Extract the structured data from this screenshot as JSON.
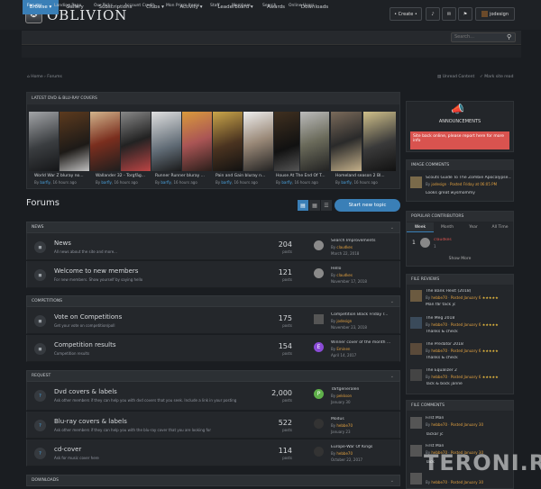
{
  "header": {
    "logo_text": "OBLIVION",
    "create_label": "• Create •",
    "user_label": "jodesign",
    "search_placeholder": "Search..."
  },
  "nav": {
    "tabs": [
      "Browse",
      "Gallery",
      "Subscriptions",
      "Clubs",
      "Activity",
      "Leaderboard",
      "Awards",
      "Downloads"
    ],
    "subtabs": [
      "Forums",
      "Landing Page",
      "Our Picks",
      "Account Credit",
      "Mon Prism Items",
      "Staff",
      "Members",
      "Search",
      "Online Users"
    ]
  },
  "breadcrumb": {
    "home": "Home",
    "current": "Forums"
  },
  "top_links": {
    "unread": "Unread Content",
    "mark_read": "Mark site read"
  },
  "latest_covers": {
    "title": "LATEST DVD & BLU-RAY COVERS",
    "items": [
      {
        "title": "World War Z bluray no...",
        "by": "barfly",
        "time": "16 hours ago"
      },
      {
        "title": "Wallander 32 - Torgfäg...",
        "by": "barfly",
        "time": "16 hours ago"
      },
      {
        "title": "Runner Runner bluray ...",
        "by": "barfly",
        "time": "16 hours ago"
      },
      {
        "title": "Pain and Gain bluray n...",
        "by": "barfly",
        "time": "16 hours ago"
      },
      {
        "title": "House At The End Of T...",
        "by": "barfly",
        "time": "16 hours ago"
      },
      {
        "title": "Homeland season 2 Bl...",
        "by": "barfly",
        "time": "16 hours ago"
      }
    ]
  },
  "forums_heading": "Forums",
  "start_topic": "Start new topic",
  "categories": [
    {
      "name": "NEWS",
      "forums": [
        {
          "title": "News",
          "desc": "All news about the site and more...",
          "count": "204",
          "posts": "posts",
          "last_title": "Search Improvements",
          "last_by": "claudkes",
          "last_date": "March 22, 2018",
          "avatar": "",
          "avatar_color": "#888"
        },
        {
          "title": "Welcome to new members",
          "desc": "For new members. Show yourself by saying hello",
          "count": "121",
          "posts": "posts",
          "last_title": "Hello",
          "last_by": "claudkes",
          "last_date": "November 17, 2018",
          "avatar": "",
          "avatar_color": "#888"
        }
      ]
    },
    {
      "name": "COMPETITIONS",
      "forums": [
        {
          "title": "Vote on Competitions",
          "desc": "Get your vote on competition/poll",
          "count": "175",
          "posts": "posts",
          "last_title": "Competition Black Friday r...",
          "last_by": "jodesign",
          "last_date": "November 23, 2018",
          "avatar": "",
          "avatar_color": "#555"
        },
        {
          "title": "Competition results",
          "desc": "Competition results",
          "count": "154",
          "posts": "posts",
          "last_title": "Winner cover of the month ...",
          "last_by": "Eminen",
          "last_date": "April 14, 2017",
          "avatar": "E",
          "avatar_color": "#8a4bd6"
        }
      ]
    },
    {
      "name": "REQUEST",
      "forums": [
        {
          "title": "Dvd covers & labels",
          "desc": "Ask other members if they can help you with dvd covers that you seek. Include a link in your posting",
          "count": "2,000",
          "posts": "posts",
          "last_title": "Tårtgeneralen",
          "last_by": "pekkson",
          "last_date": "January 30",
          "avatar": "P",
          "avatar_color": "#5fb04a"
        },
        {
          "title": "Blu-ray covers & labels",
          "desc": "Ask other members if they can help you with the blu-ray cover that you are looking for",
          "count": "522",
          "posts": "posts",
          "last_title": "Modus",
          "last_by": "hebbe70",
          "last_date": "January 23",
          "avatar": "",
          "avatar_color": "#333"
        },
        {
          "title": "cd-cover",
          "desc": "Ask for music cover here",
          "count": "114",
          "posts": "posts",
          "last_title": "Europe-War Of Kings",
          "last_by": "hebbe70",
          "last_date": "October 22, 2017",
          "avatar": "",
          "avatar_color": "#333"
        }
      ]
    },
    {
      "name": "DOWNLOADS",
      "forums": []
    }
  ],
  "sidebar": {
    "announcements": {
      "title": "ANNOUNCEMENTS",
      "alert": "Site back online, please report here for more info"
    },
    "image_comments": {
      "title": "IMAGE COMMENTS",
      "item_title": "Scouts Guide To The Zombie Apocalypse...",
      "by": "jodesign",
      "time": "Posted Friday at 06:05 PM",
      "comment": "Looks great wysmommy"
    },
    "popular": {
      "title": "POPULAR CONTRIBUTORS",
      "tabs": [
        "Week",
        "Month",
        "Year",
        "All Time"
      ],
      "rank": "1",
      "user": "claudkes",
      "points": "1",
      "show_more": "Show More"
    },
    "file_reviews": {
      "title": "FILE REVIEWS",
      "items": [
        {
          "title": "The Bank Heist (2018)",
          "by": "hebbe70",
          "posted": "Posted January 6",
          "comment": "Man får tack jc"
        },
        {
          "title": "The Meg 2018",
          "by": "hebbe70",
          "posted": "Posted January 6",
          "comment": "Thanks & check"
        },
        {
          "title": "The Predator 2018",
          "by": "hebbe70",
          "posted": "Posted January 6",
          "comment": "Thanks & check"
        },
        {
          "title": "The Equalizer 2",
          "by": "hebbe70",
          "posted": "Posted January 6",
          "comment": "Tack & bock janne"
        }
      ]
    },
    "file_comments": {
      "title": "FILE COMMENTS",
      "items": [
        {
          "title": "First Man",
          "by": "hebbe70",
          "posted": "Posted January 30",
          "comment": "Tackar jc"
        },
        {
          "title": "First Man",
          "by": "hebbe70",
          "posted": "Posted January 30",
          "comment": "Tack"
        },
        {
          "title": "",
          "by": "hebbe70",
          "posted": "Posted January 30",
          "comment": ""
        }
      ]
    }
  },
  "watermark": "TERONI.RU"
}
